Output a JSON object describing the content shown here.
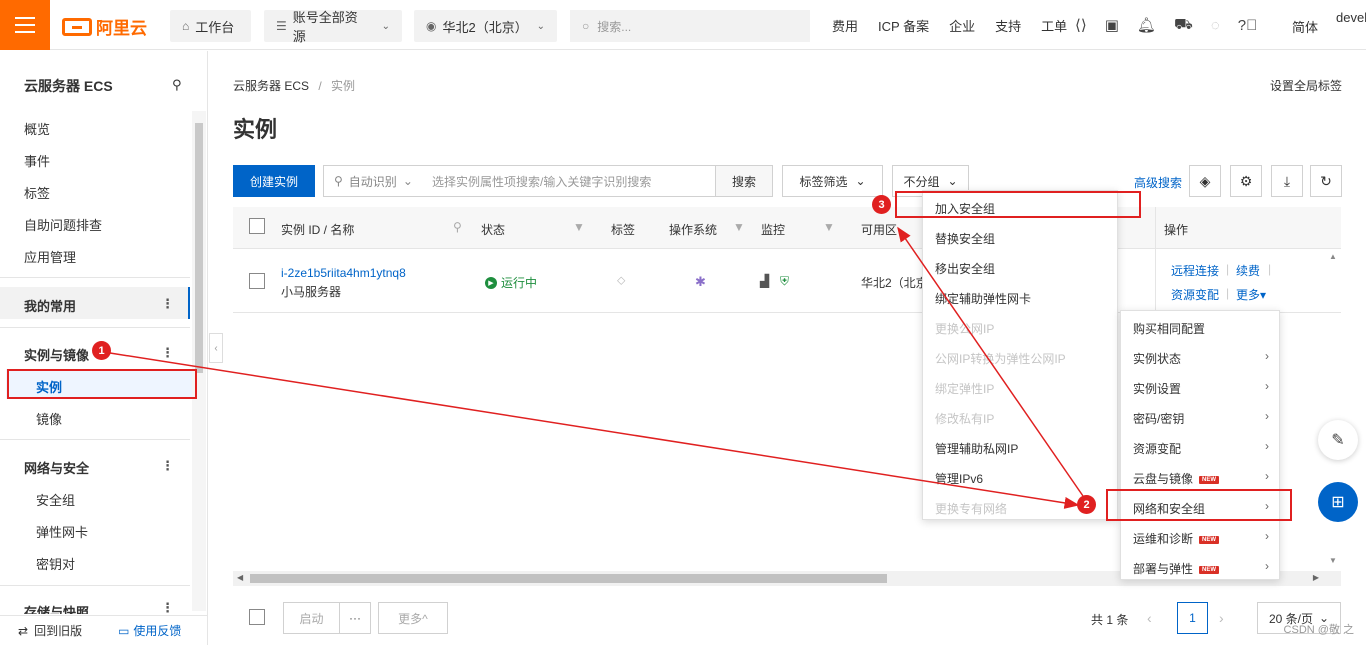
{
  "topbar": {
    "logo": "阿里云",
    "workbench": "工作台",
    "resources": "账号全部资源",
    "region": "华北2（北京）",
    "search_placeholder": "搜索...",
    "links": [
      "费用",
      "ICP 备案",
      "企业",
      "支持",
      "工单"
    ],
    "lang": "简体",
    "user": "devel",
    "brand_color": "#ff6a00"
  },
  "sidebar": {
    "title": "云服务器 ECS",
    "items": [
      "概览",
      "事件",
      "标签",
      "自助问题排查",
      "应用管理"
    ],
    "favorites": "我的常用",
    "group_instances": "实例与镜像",
    "instances": "实例",
    "images": "镜像",
    "group_network": "网络与安全",
    "security_group": "安全组",
    "eni": "弹性网卡",
    "keypair": "密钥对",
    "group_storage": "存储与快照",
    "back_old": "回到旧版",
    "feedback": "使用反馈"
  },
  "main": {
    "breadcrumb_root": "云服务器 ECS",
    "breadcrumb_sep": "/",
    "breadcrumb_current": "实例",
    "global_tag": "设置全局标签",
    "title": "实例",
    "create_btn": "创建实例",
    "auto_detect": "自动识别",
    "search_placeholder": "选择实例属性项搜索/输入关键字识别搜索",
    "search_btn": "搜索",
    "tag_filter": "标签筛选",
    "no_group": "不分组",
    "adv_search": "高级搜索"
  },
  "table": {
    "headers": {
      "id": "实例 ID / 名称",
      "status": "状态",
      "tags": "标签",
      "os": "操作系统",
      "monitor": "监控",
      "zone": "可用区",
      "ops": "操作"
    },
    "row": {
      "id": "i-2ze1b5riita4hm1ytnq8",
      "name": "小马服务器",
      "status": "运行中",
      "zone": "华北2（北京",
      "remote": "远程连接",
      "renew": "续费",
      "change": "资源变配",
      "more": "更多▾"
    }
  },
  "footer": {
    "start": "启动",
    "ellipsis": "···",
    "more": "更多^",
    "total": "共 1 条",
    "page": "1",
    "page_size": "20 条/页",
    "watermark": "CSDN @敬 之"
  },
  "submenu_network": {
    "items": [
      {
        "label": "加入安全组",
        "enabled": true
      },
      {
        "label": "替换安全组",
        "enabled": true
      },
      {
        "label": "移出安全组",
        "enabled": true
      },
      {
        "label": "绑定辅助弹性网卡",
        "enabled": true
      },
      {
        "label": "更换公网IP",
        "enabled": false
      },
      {
        "label": "公网IP转换为弹性公网IP",
        "enabled": false
      },
      {
        "label": "绑定弹性IP",
        "enabled": false
      },
      {
        "label": "修改私有IP",
        "enabled": false
      },
      {
        "label": "管理辅助私网IP",
        "enabled": true
      },
      {
        "label": "管理IPv6",
        "enabled": true
      },
      {
        "label": "更换专有网络",
        "enabled": false
      }
    ]
  },
  "more_menu": {
    "items": [
      {
        "label": "购买相同配置",
        "arrow": false,
        "new": false
      },
      {
        "label": "实例状态",
        "arrow": true,
        "new": false
      },
      {
        "label": "实例设置",
        "arrow": true,
        "new": false
      },
      {
        "label": "密码/密钥",
        "arrow": true,
        "new": false
      },
      {
        "label": "资源变配",
        "arrow": true,
        "new": false
      },
      {
        "label": "云盘与镜像",
        "arrow": true,
        "new": true
      },
      {
        "label": "网络和安全组",
        "arrow": true,
        "new": false
      },
      {
        "label": "运维和诊断",
        "arrow": true,
        "new": true
      },
      {
        "label": "部署与弹性",
        "arrow": true,
        "new": true
      }
    ],
    "new_badge": "NEW"
  },
  "annotations": {
    "step1": "1",
    "step2": "2",
    "step3": "3",
    "color": "#e02020"
  }
}
